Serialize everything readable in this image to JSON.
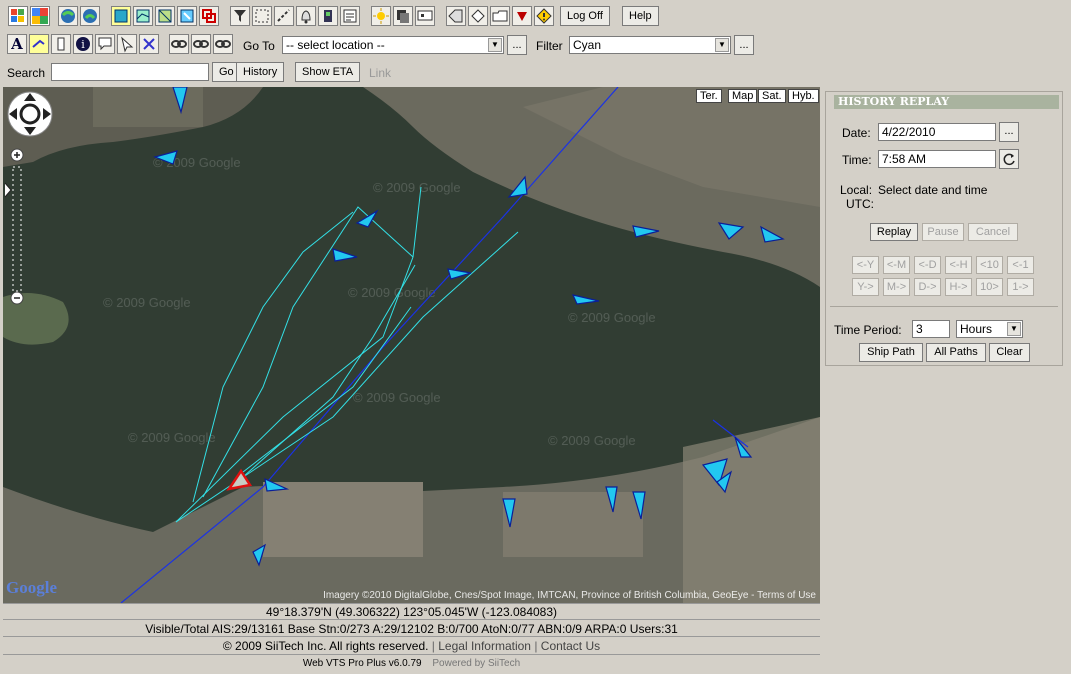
{
  "toolbar": {
    "logoff_label": "Log Off",
    "help_label": "Help",
    "goto_label": "Go To",
    "goto_value": "-- select location --",
    "filter_label": "Filter",
    "filter_value": "Cyan",
    "ellipsis": "..."
  },
  "search": {
    "label": "Search",
    "value": "",
    "go_label": "Go",
    "history_label": "History",
    "show_eta_label": "Show ETA",
    "link_label": "Link"
  },
  "map": {
    "types": [
      "Ter.",
      "Map",
      "Sat.",
      "Hyb."
    ],
    "watermark": "© 2009 Google",
    "attribution": "Imagery ©2010 DigitalGlobe, Cnes/Spot Image, IMTCAN, Province of British Columbia, GeoEye - Terms of Use",
    "logo": "Google"
  },
  "history": {
    "title": "HISTORY REPLAY",
    "date_label": "Date:",
    "date_value": "4/22/2010",
    "time_label": "Time:",
    "time_value": "7:58 AM",
    "local_label": "Local:",
    "local_value": "Select date and time",
    "utc_label": "UTC:",
    "replay": "Replay",
    "pause": "Pause",
    "cancel": "Cancel",
    "back_steps": [
      "<-Y",
      "<-M",
      "<-D",
      "<-H",
      "<10",
      "<-1"
    ],
    "fwd_steps": [
      "Y->",
      "M->",
      "D->",
      "H->",
      "10>",
      "1->"
    ],
    "time_period_label": "Time Period:",
    "time_period_value": "3",
    "time_unit": "Hours",
    "ship_path": "Ship Path",
    "all_paths": "All Paths",
    "clear": "Clear"
  },
  "status": {
    "coords": "49°18.379'N (49.306322)    123°05.045'W (-123.084083)",
    "counts": "Visible/Total AIS:29/13161  Base Stn:0/273  A:29/12102  B:0/700  AtoN:0/77  ABN:0/9  ARPA:0  Users:31",
    "copyright": "© 2009 SiiTech Inc. All rights reserved.",
    "legal": "Legal Information",
    "contact": "Contact Us",
    "version": "Web VTS Pro Plus v6.0.79",
    "powered": "Powered by SiiTech"
  }
}
